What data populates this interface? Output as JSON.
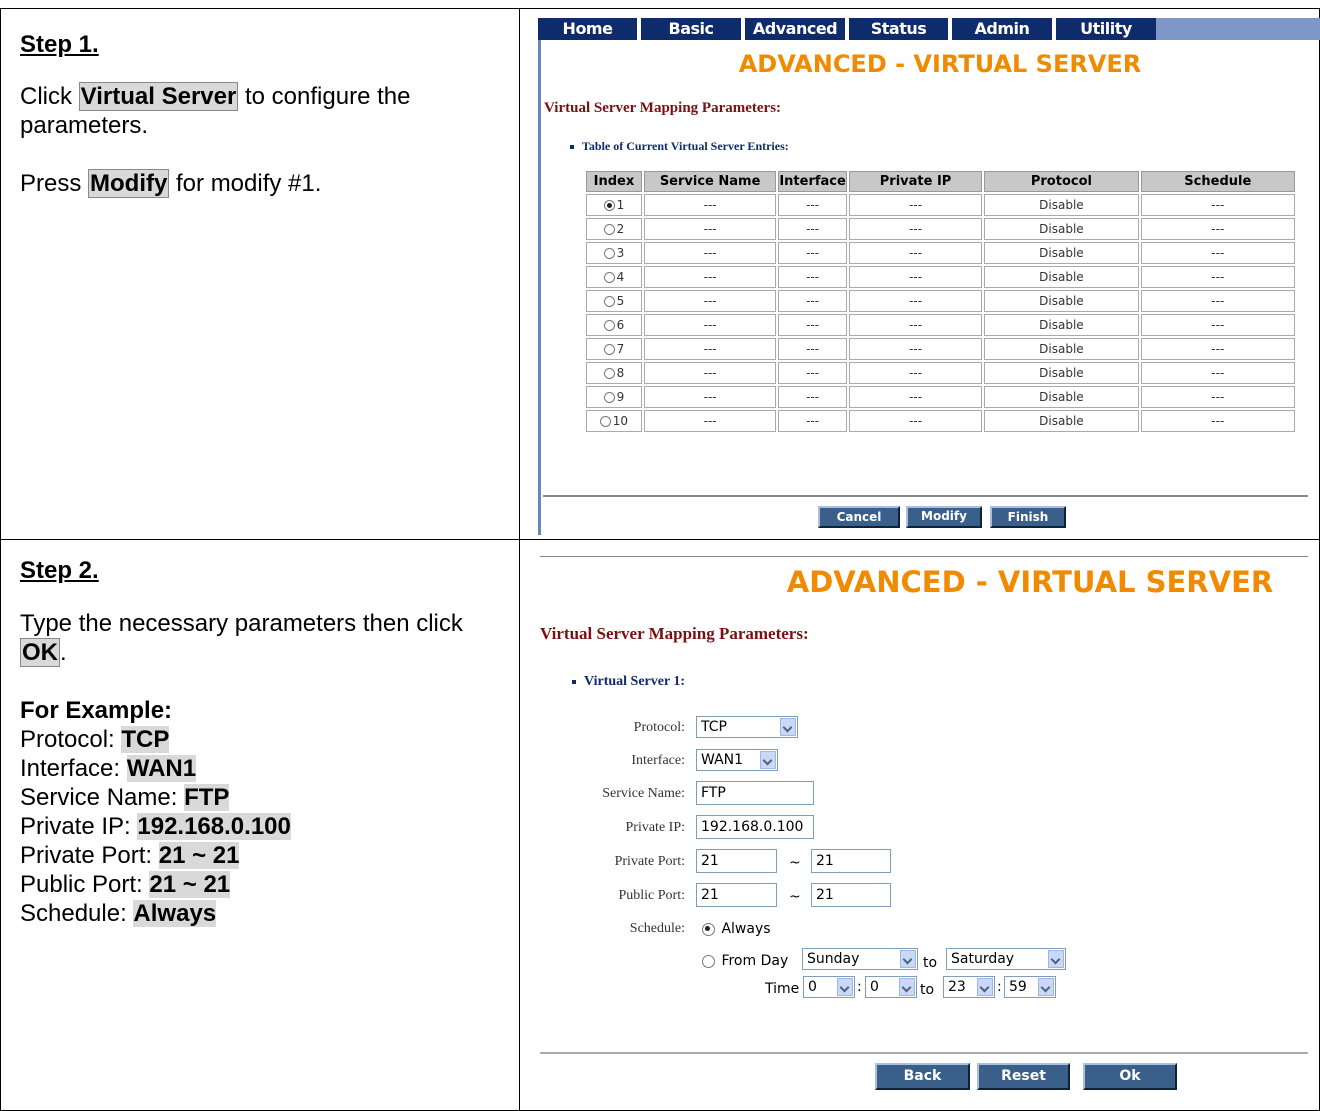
{
  "step1": {
    "title": "Step 1.",
    "click_prefix": "Click ",
    "click_target": "Virtual Server",
    "click_suffix": " to configure the",
    "click_line2": "parameters.",
    "press_prefix": "Press ",
    "press_target": "Modify",
    "press_suffix": " for modify #1."
  },
  "step2": {
    "title": "Step 2.",
    "line1": "Type the necessary parameters then click",
    "ok_target": "OK",
    "ok_suffix": ".",
    "example_heading": "For Example:",
    "examples": [
      {
        "label": "Protocol: ",
        "value": "TCP"
      },
      {
        "label": "Interface: ",
        "value": "WAN1"
      },
      {
        "label": "Service Name: ",
        "value": "FTP"
      },
      {
        "label": "Private IP: ",
        "value": "192.168.0.100"
      },
      {
        "label": "Private Port: ",
        "value": "21 ~ 21"
      },
      {
        "label": "Public Port: ",
        "value": "21 ~ 21"
      },
      {
        "label": "Schedule: ",
        "value": "Always"
      }
    ]
  },
  "nav": [
    "Home",
    "Basic",
    "Advanced",
    "Status",
    "Admin",
    "Utility"
  ],
  "screen1": {
    "page_title": "ADVANCED - VIRTUAL SERVER",
    "section_title": "Virtual Server Mapping Parameters:",
    "table_label": "Table of Current Virtual Server Entries:",
    "columns": [
      "Index",
      "Service Name",
      "Interface",
      "Private IP",
      "Protocol",
      "Schedule"
    ],
    "rows": [
      {
        "index": "1",
        "service": "---",
        "iface": "---",
        "ip": "---",
        "protocol": "Disable",
        "schedule": "---"
      },
      {
        "index": "2",
        "service": "---",
        "iface": "---",
        "ip": "---",
        "protocol": "Disable",
        "schedule": "---"
      },
      {
        "index": "3",
        "service": "---",
        "iface": "---",
        "ip": "---",
        "protocol": "Disable",
        "schedule": "---"
      },
      {
        "index": "4",
        "service": "---",
        "iface": "---",
        "ip": "---",
        "protocol": "Disable",
        "schedule": "---"
      },
      {
        "index": "5",
        "service": "---",
        "iface": "---",
        "ip": "---",
        "protocol": "Disable",
        "schedule": "---"
      },
      {
        "index": "6",
        "service": "---",
        "iface": "---",
        "ip": "---",
        "protocol": "Disable",
        "schedule": "---"
      },
      {
        "index": "7",
        "service": "---",
        "iface": "---",
        "ip": "---",
        "protocol": "Disable",
        "schedule": "---"
      },
      {
        "index": "8",
        "service": "---",
        "iface": "---",
        "ip": "---",
        "protocol": "Disable",
        "schedule": "---"
      },
      {
        "index": "9",
        "service": "---",
        "iface": "---",
        "ip": "---",
        "protocol": "Disable",
        "schedule": "---"
      },
      {
        "index": "10",
        "service": "---",
        "iface": "---",
        "ip": "---",
        "protocol": "Disable",
        "schedule": "---"
      }
    ],
    "selected_index": "1",
    "buttons": {
      "cancel": "Cancel",
      "modify": "Modify",
      "finish": "Finish"
    }
  },
  "screen2": {
    "page_title": "ADVANCED - VIRTUAL SERVER",
    "section_title": "Virtual Server Mapping Parameters:",
    "sub_title": "Virtual Server 1:",
    "labels": {
      "protocol": "Protocol:",
      "interface": "Interface:",
      "service_name": "Service Name:",
      "private_ip": "Private IP:",
      "private_port": "Private Port:",
      "public_port": "Public Port:",
      "schedule": "Schedule:"
    },
    "values": {
      "protocol": "TCP",
      "interface": "WAN1",
      "service_name": "FTP",
      "private_ip": "192.168.0.100",
      "private_port_from": "21",
      "private_port_to": "21",
      "public_port_from": "21",
      "public_port_to": "21"
    },
    "tilde": "~",
    "schedule_always": "Always",
    "schedule_from_day": "From Day",
    "day_from": "Sunday",
    "day_to": "Saturday",
    "to": "to",
    "time_label": "Time",
    "time_from_h": "0",
    "time_from_m": "0",
    "time_to_h": "23",
    "time_to_m": "59",
    "colon": ":",
    "buttons": {
      "back": "Back",
      "reset": "Reset",
      "ok": "Ok"
    }
  }
}
